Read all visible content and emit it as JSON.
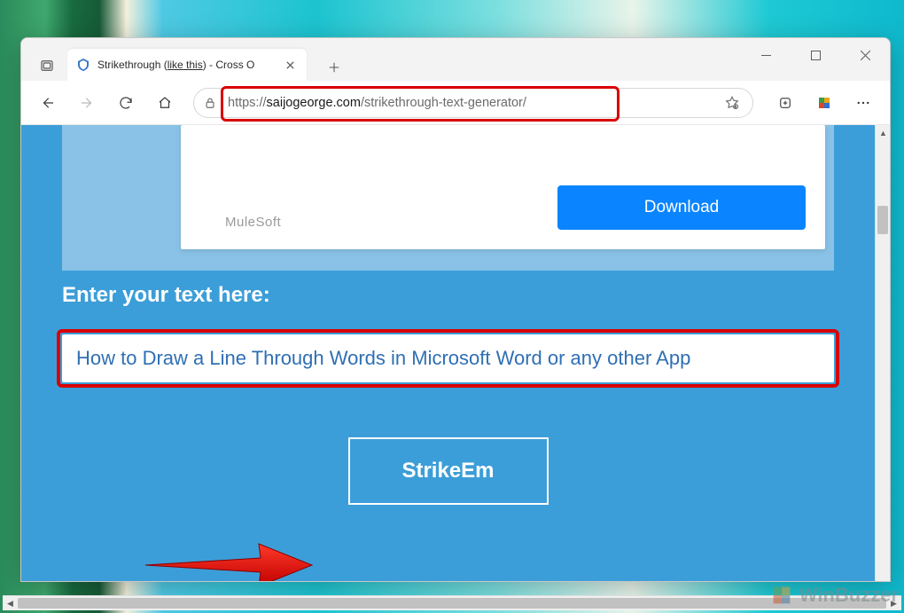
{
  "browser": {
    "tab": {
      "title_prefix": "Strikethrough (",
      "title_underlined": "like this",
      "title_suffix": ") - Cross O"
    },
    "url": {
      "scheme": "https://",
      "host": "saijogeorge.com",
      "path": "/strikethrough-text-generator/"
    }
  },
  "page": {
    "ad_brand": "MuleSoft",
    "ad_cta": "Download",
    "enter_label": "Enter your text here:",
    "input_value": "How to Draw a Line Through Words in Microsoft Word or any other App",
    "strike_button": "StrikeEm"
  },
  "watermark": "WinBuzzer"
}
